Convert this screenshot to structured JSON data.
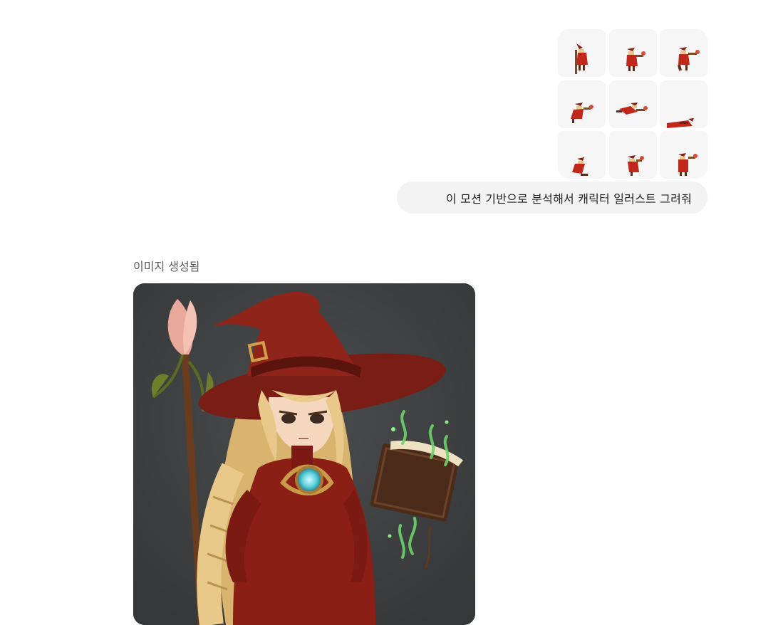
{
  "user_message": {
    "text": "이 모션 기반으로 분석해서 캐릭터 일러스트 그려줘",
    "attachments": [
      {
        "pose": "standing-staff"
      },
      {
        "pose": "cast-1"
      },
      {
        "pose": "cast-2"
      },
      {
        "pose": "dash-1"
      },
      {
        "pose": "dash-2"
      },
      {
        "pose": "knocked-down"
      },
      {
        "pose": "hurt-1"
      },
      {
        "pose": "hurt-2"
      },
      {
        "pose": "hurt-3"
      }
    ]
  },
  "assistant_message": {
    "status_label": "이미지 생성됨",
    "image_subject": "witch-character-illustration"
  },
  "colors": {
    "bubble_bg": "#f3f3f3",
    "thumb_bg": "#f6f6f6",
    "label_gray": "#5d5d5d",
    "image_bg": "#3d3f40",
    "robe_red": "#8b1f16",
    "hair_blond": "#e8c98a",
    "magic_green": "#6dd36b"
  }
}
